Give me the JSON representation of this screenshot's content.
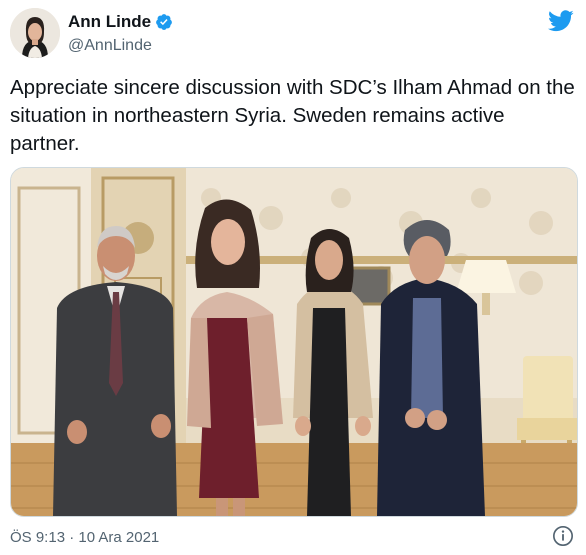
{
  "author": {
    "display_name": "Ann Linde",
    "handle": "@AnnLinde",
    "verified": true
  },
  "tweet": {
    "text": "Appreciate sincere discussion with SDC’s Ilham Ahmad on the situation in northeastern Syria. Sweden remains active partner."
  },
  "footer": {
    "time": "ÖS 9:13 · 10 Ara 2021"
  },
  "icons": {
    "verified": "verified-badge-icon",
    "twitter": "twitter-bird-icon",
    "info": "info-icon"
  },
  "colors": {
    "accent": "#1d9bf0",
    "text": "#0f1419",
    "muted": "#536471"
  }
}
